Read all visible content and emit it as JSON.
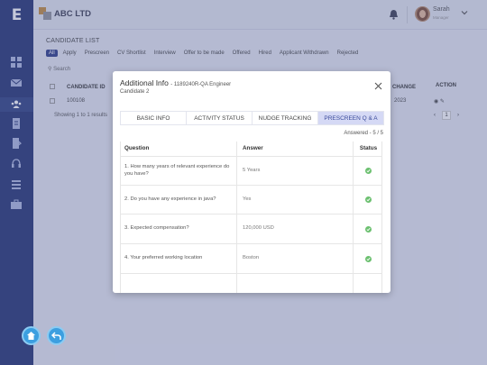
{
  "header": {
    "brand_name": "ABC LTD",
    "user_name": "Sarah",
    "user_role": "Manager"
  },
  "page": {
    "title": "CANDIDATE LIST",
    "filters": [
      "All",
      "Apply",
      "Prescreen",
      "CV Shortlist",
      "Interview",
      "Offer to be made",
      "Offered",
      "Hired",
      "Applicant Withdrawn",
      "Rejected"
    ],
    "search_placeholder": "Search",
    "columns": {
      "candidate_id": "CANDIDATE ID",
      "change": "CHANGE",
      "action": "ACTION"
    },
    "row": {
      "candidate_id": "100108",
      "date": "2023"
    },
    "showing": "Showing 1 to 1 results",
    "page_number": "1"
  },
  "modal": {
    "title": "Additional Info",
    "job": "- 1189240R-QA Engineer",
    "candidate": "Candidate 2",
    "tabs": [
      "BASIC INFO",
      "ACTIVITY STATUS",
      "NUDGE TRACKING",
      "PRESCREEN Q & A"
    ],
    "active_tab": "PRESCREEN Q & A",
    "answered": "Answered - 5 / 5",
    "table_headers": {
      "question": "Question",
      "answer": "Answer",
      "status": "Status"
    },
    "rows": [
      {
        "question": "1. How many years of relevant experience do you have?",
        "answer": "5 Years"
      },
      {
        "question": "2. Do you have any experience in java?",
        "answer": "Yes"
      },
      {
        "question": "3. Expected compensation?",
        "answer": "120,000 USD"
      },
      {
        "question": "4. Your preferred working location",
        "answer": "Boston"
      },
      {
        "question": "",
        "answer": ""
      }
    ]
  },
  "colors": {
    "sidebar": "#223272",
    "accent": "#2c3b87",
    "active_tab_bg": "#d5d9f5",
    "status_ok": "#6cc070",
    "fab": "#3c9fe0"
  }
}
